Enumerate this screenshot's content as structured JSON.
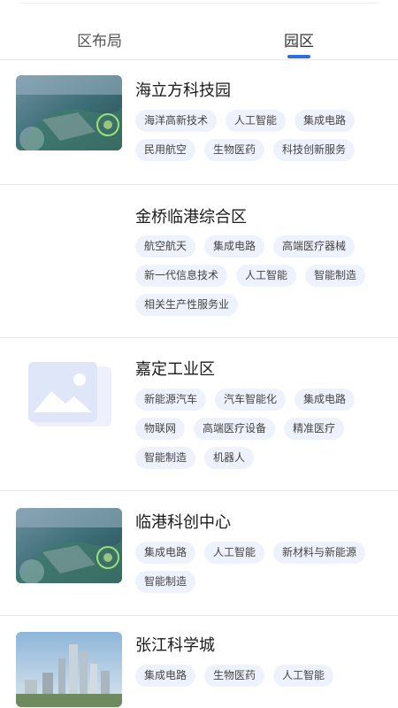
{
  "tabs": {
    "left_label": "区布局",
    "right_label": "园区",
    "active": "园区",
    "accent_color": "#2f6fde"
  },
  "parks": [
    {
      "name": "海立方科技园",
      "image": "aerial-city-photo",
      "tags": [
        "海洋高新技术",
        "人工智能",
        "集成电路",
        "民用航空",
        "生物医药",
        "科技创新服务"
      ]
    },
    {
      "name": "金桥临港综合区",
      "image": "none",
      "tags": [
        "航空航天",
        "集成电路",
        "高端医疗器械",
        "新一代信息技术",
        "人工智能",
        "智能制造",
        "相关生产性服务业"
      ]
    },
    {
      "name": "嘉定工业区",
      "image": "image-placeholder-icon",
      "tags": [
        "新能源汽车",
        "汽车智能化",
        "集成电路",
        "物联网",
        "高端医疗设备",
        "精准医疗",
        "智能制造",
        "机器人"
      ]
    },
    {
      "name": "临港科创中心",
      "image": "aerial-city-photo",
      "tags": [
        "集成电路",
        "人工智能",
        "新材料与新能源",
        "智能制造"
      ]
    },
    {
      "name": "张江科学城",
      "image": "skyline-photo",
      "tags": [
        "集成电路",
        "生物医药",
        "人工智能"
      ]
    }
  ]
}
